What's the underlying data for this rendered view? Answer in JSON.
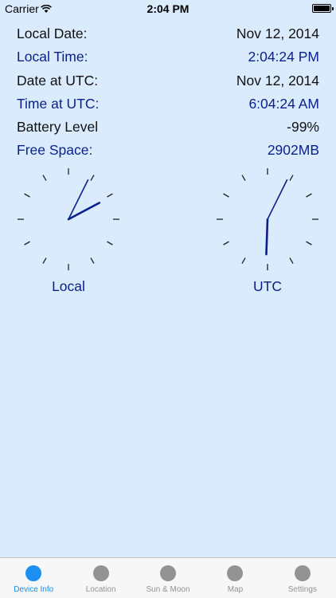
{
  "status_bar": {
    "carrier": "Carrier",
    "time": "2:04 PM"
  },
  "info": [
    {
      "label": "Local Date:",
      "value": "Nov 12, 2014",
      "color": "dark"
    },
    {
      "label": "Local Time:",
      "value": "2:04:24 PM",
      "color": "blue"
    },
    {
      "label": "Date at UTC:",
      "value": "Nov 12, 2014",
      "color": "dark"
    },
    {
      "label": "Time at UTC:",
      "value": "6:04:24 AM",
      "color": "blue"
    },
    {
      "label": "Battery Level",
      "value": "-99%",
      "color": "dark"
    },
    {
      "label": "Free Space:",
      "value": "2902MB",
      "color": "blue"
    }
  ],
  "clocks": {
    "local": {
      "label": "Local",
      "hour": 2,
      "minute": 4,
      "second": 24
    },
    "utc": {
      "label": "UTC",
      "hour": 6,
      "minute": 4,
      "second": 24
    }
  },
  "colors": {
    "background": "#d9ebfd",
    "accent": "#1b8ff2",
    "text_blue": "#0b1f8c",
    "hand": "#0b1f8c"
  },
  "tabs": [
    {
      "label": "Device Info",
      "icon": "circle-icon",
      "active": true
    },
    {
      "label": "Location",
      "icon": "circle-icon",
      "active": false
    },
    {
      "label": "Sun & Moon",
      "icon": "circle-icon",
      "active": false
    },
    {
      "label": "Map",
      "icon": "circle-icon",
      "active": false
    },
    {
      "label": "Settings",
      "icon": "circle-icon",
      "active": false
    }
  ]
}
